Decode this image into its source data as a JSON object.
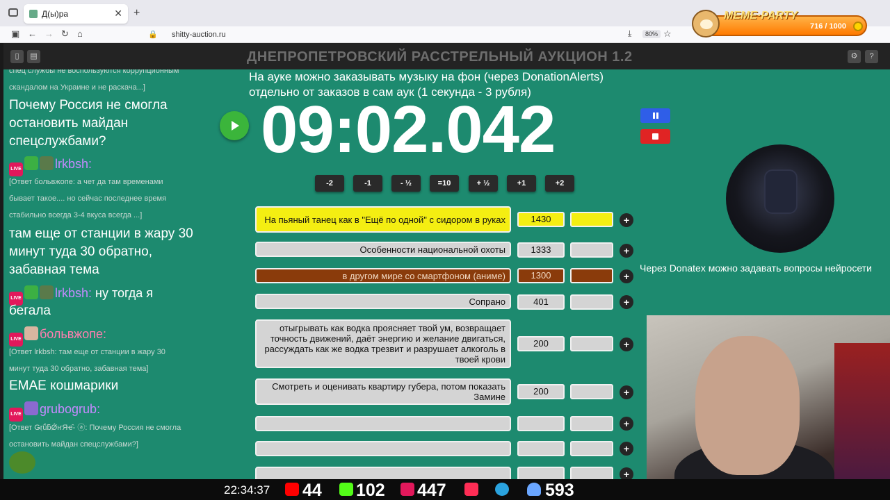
{
  "browser": {
    "tab_title": "Д(ы)ра",
    "url": "shitty-auction.ru",
    "zoom": "80%"
  },
  "meme_party": {
    "title": "MEME·PARTY",
    "score": "716 / 1000"
  },
  "page": {
    "title": "ДНЕПРОПЕТРОВСКИЙ РАССТРЕЛЬНЫЙ АУКЦИОН 1.2",
    "subtitle_line1": "На ауке можно заказывать музыку на фон (через DonationAlerts)",
    "subtitle_line2": "отдельно от заказов в сам аук (1 секунда - 3 рубля)"
  },
  "chat": [
    {
      "type": "reply",
      "text": "спец службы не воспользуются коррупционным"
    },
    {
      "type": "reply",
      "text": "скандалом на Украине и не раскача...]"
    },
    {
      "type": "message",
      "text": "Почему Россия не смогла"
    },
    {
      "type": "message",
      "text": "остановить майдан"
    },
    {
      "type": "message",
      "text": "спецслужбами?"
    },
    {
      "type": "user",
      "name": "lrkbsh:"
    },
    {
      "type": "reply",
      "text": "[Ответ больвжопе: а чет да там временами"
    },
    {
      "type": "reply",
      "text": "бывает такое.... но сейчас последнее время"
    },
    {
      "type": "reply",
      "text": "стабильно всегда 3-4 вкуса всегда ...]"
    },
    {
      "type": "message",
      "text": "там еще от станции в жару 30"
    },
    {
      "type": "message",
      "text": "минут туда 30 обратно,"
    },
    {
      "type": "message",
      "text": "забавная тема"
    },
    {
      "type": "user_msg",
      "name": "lrkbsh:",
      "text": "ну тогда я"
    },
    {
      "type": "message",
      "text": "бегала"
    },
    {
      "type": "user",
      "name": "больвжопе:"
    },
    {
      "type": "reply",
      "text": "[Ответ lrkbsh: там еще от станции в жару 30"
    },
    {
      "type": "reply",
      "text": "минут туда 30 обратно, забавная тема]"
    },
    {
      "type": "message",
      "text": "EMAE кошмарики"
    },
    {
      "type": "user",
      "name": "grubogrub:"
    },
    {
      "type": "reply",
      "text": "[Ответ ǤṛṹƃǾҥЯҽ̂- ⓐ: Почему Россия не смогла"
    },
    {
      "type": "reply",
      "text": "остановить майдан спецслужбами?]"
    }
  ],
  "timer": "09:02.042",
  "adjust_buttons": [
    "-2",
    "-1",
    "- ½",
    "=10",
    "+ ½",
    "+1",
    "+2"
  ],
  "lots": [
    {
      "name": "На пьяный танец как в \"Ещё по одной\" с сидором в руках",
      "amount": "1430",
      "style": "yellow"
    },
    {
      "name": "Особенности национальной охоты",
      "amount": "1333",
      "style": "grey"
    },
    {
      "name": "в другом мире со смартфоном (аниме)",
      "amount": "1300",
      "style": "brown"
    },
    {
      "name": "Сопрано",
      "amount": "401",
      "style": "grey"
    },
    {
      "name": "отыгрывать как водка проясняет твой ум, возвращает точность движений, даёт энергию и желание двигаться, рассуждать как же водка трезвит и разрушает алкоголь в твоей крови",
      "amount": "200",
      "style": "grey"
    },
    {
      "name": "Смотреть и оценивать квартиру губера, потом показать Замине",
      "amount": "200",
      "style": "grey"
    },
    {
      "name": "",
      "amount": "",
      "style": "grey"
    },
    {
      "name": "",
      "amount": "",
      "style": "grey"
    },
    {
      "name": "",
      "amount": "",
      "style": "grey"
    }
  ],
  "plus_label": "+",
  "donatex_text": "Через Donatex можно задавать вопросы нейросети",
  "stream_bar": {
    "clock": "22:34:37",
    "youtube": "44",
    "kick": "102",
    "vk": "447",
    "viewers": "593"
  }
}
